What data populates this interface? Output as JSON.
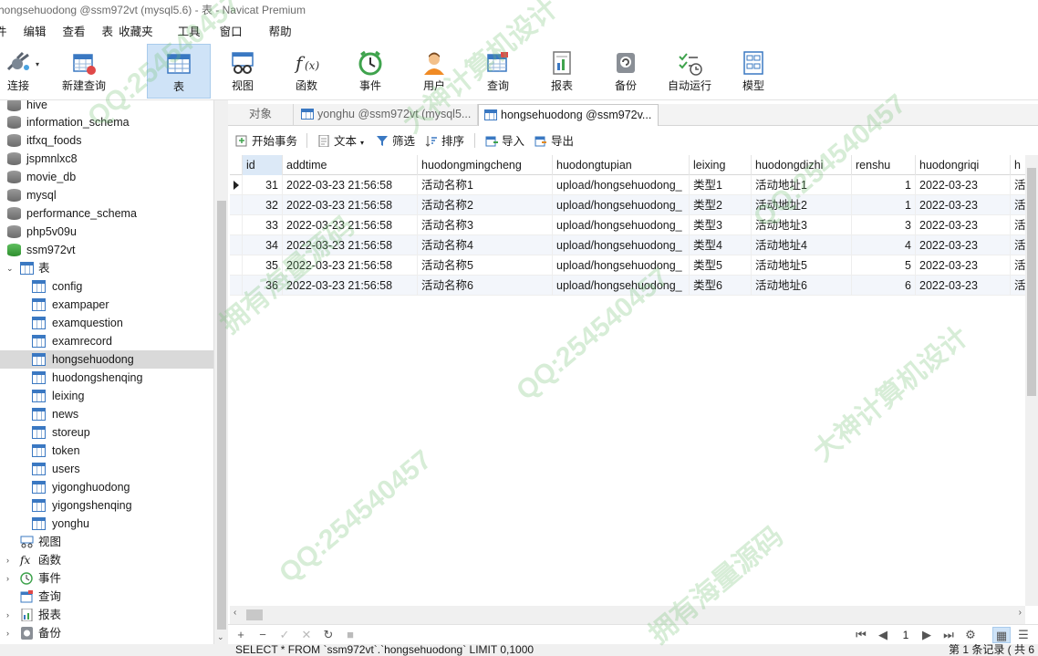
{
  "window": {
    "title": "hongsehuodong @ssm972vt (mysql5.6) - 表 - Navicat Premium"
  },
  "menu": [
    "件",
    "编辑",
    "查看",
    "表",
    "收藏夹",
    "工具",
    "窗口",
    "帮助"
  ],
  "toolbar": [
    {
      "label": "连接",
      "icon": "plug-icon"
    },
    {
      "label": "新建查询",
      "icon": "new-query-icon"
    },
    {
      "label": "表",
      "icon": "table-icon",
      "active": true
    },
    {
      "label": "视图",
      "icon": "view-icon"
    },
    {
      "label": "函数",
      "icon": "function-icon"
    },
    {
      "label": "事件",
      "icon": "clock-icon"
    },
    {
      "label": "用户",
      "icon": "user-icon"
    },
    {
      "label": "查询",
      "icon": "query-icon"
    },
    {
      "label": "报表",
      "icon": "report-icon"
    },
    {
      "label": "备份",
      "icon": "backup-icon"
    },
    {
      "label": "自动运行",
      "icon": "autorun-icon"
    },
    {
      "label": "模型",
      "icon": "model-icon"
    }
  ],
  "tree": {
    "databases_top": [
      "hive",
      "information_schema",
      "itfxq_foods",
      "jspmnlxc8",
      "movie_db",
      "mysql",
      "performance_schema",
      "php5v09u"
    ],
    "open_db": "ssm972vt",
    "tables_label": "表",
    "tables": [
      "config",
      "exampaper",
      "examquestion",
      "examrecord",
      "hongsehuodong",
      "huodongshenqing",
      "leixing",
      "news",
      "storeup",
      "token",
      "users",
      "yigonghuodong",
      "yigongshenqing",
      "yonghu"
    ],
    "selected_table": "hongsehuodong",
    "groups": [
      "视图",
      "函数",
      "事件",
      "查询",
      "报表",
      "备份"
    ]
  },
  "tabs": [
    {
      "label": "对象"
    },
    {
      "label": "yonghu @ssm972vt (mysql5..."
    },
    {
      "label": "hongsehuodong @ssm972v...",
      "active": true
    }
  ],
  "objbar": {
    "begin_tx": "开始事务",
    "text": "文本",
    "filter": "筛选",
    "sort": "排序",
    "import": "导入",
    "export": "导出"
  },
  "grid": {
    "columns": [
      "id",
      "addtime",
      "huodongmingcheng",
      "huodongtupian",
      "leixing",
      "huodongdizhi",
      "renshu",
      "huodongriqi",
      "h"
    ],
    "rows": [
      [
        "31",
        "2022-03-23 21:56:58",
        "活动名称1",
        "upload/hongsehuodong_",
        "类型1",
        "活动地址1",
        "1",
        "2022-03-23",
        "活"
      ],
      [
        "32",
        "2022-03-23 21:56:58",
        "活动名称2",
        "upload/hongsehuodong_",
        "类型2",
        "活动地址2",
        "1",
        "2022-03-23",
        "活"
      ],
      [
        "33",
        "2022-03-23 21:56:58",
        "活动名称3",
        "upload/hongsehuodong_",
        "类型3",
        "活动地址3",
        "3",
        "2022-03-23",
        "活"
      ],
      [
        "34",
        "2022-03-23 21:56:58",
        "活动名称4",
        "upload/hongsehuodong_",
        "类型4",
        "活动地址4",
        "4",
        "2022-03-23",
        "活"
      ],
      [
        "35",
        "2022-03-23 21:56:58",
        "活动名称5",
        "upload/hongsehuodong_",
        "类型5",
        "活动地址5",
        "5",
        "2022-03-23",
        "活"
      ],
      [
        "36",
        "2022-03-23 21:56:58",
        "活动名称6",
        "upload/hongsehuodong_",
        "类型6",
        "活动地址6",
        "6",
        "2022-03-23",
        "活"
      ]
    ]
  },
  "nav": {
    "page": "1"
  },
  "status": {
    "sql": "SELECT * FROM `ssm972vt`.`hongsehuodong` LIMIT 0,1000",
    "count": "第 1 条记录 ( 共 6"
  },
  "watermark": [
    "QQ:254540457",
    "大神计算机设计",
    "拥有海量源码"
  ]
}
